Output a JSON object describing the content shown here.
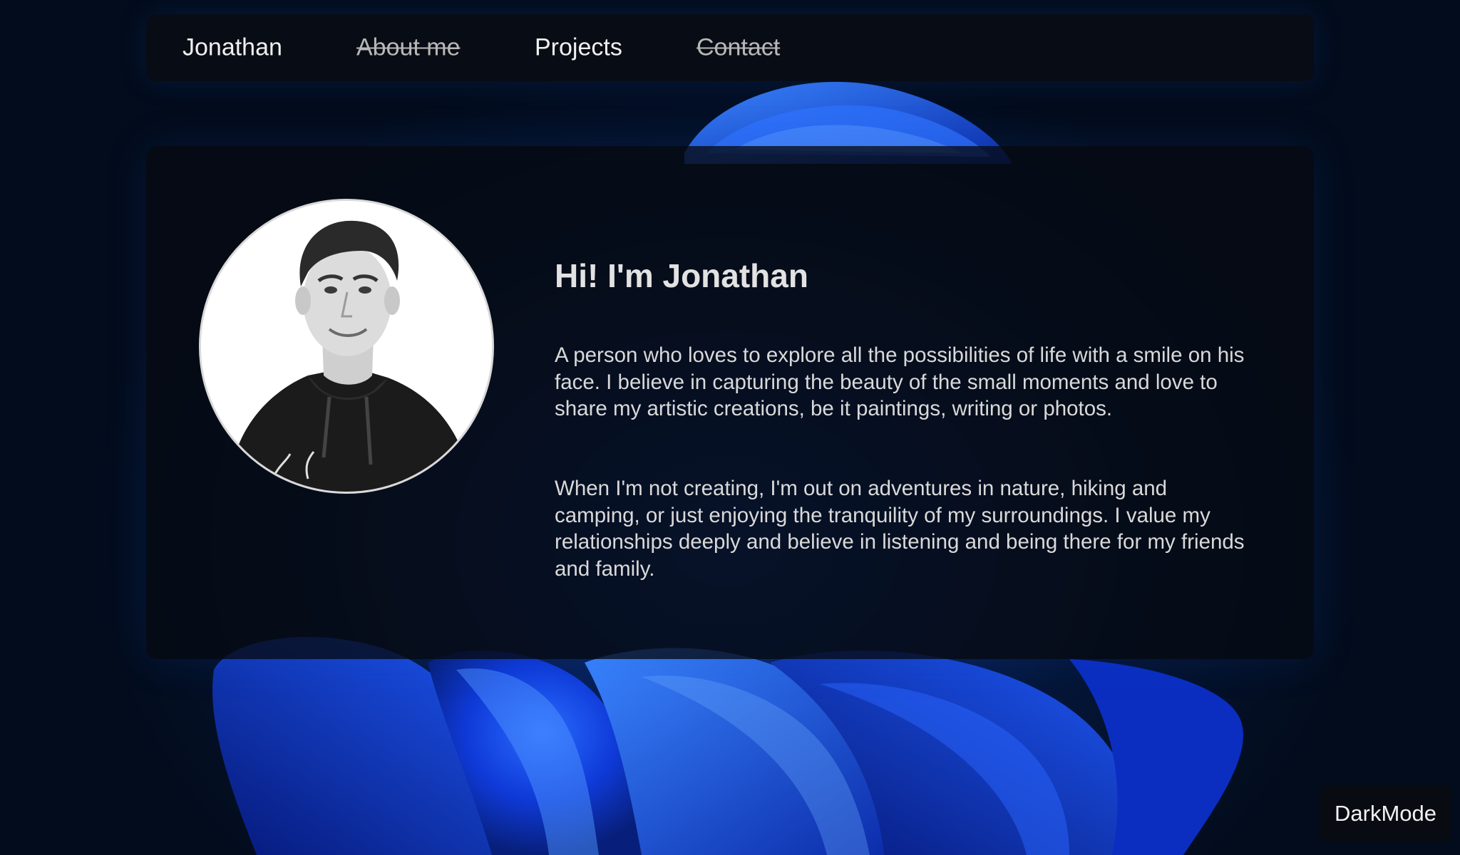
{
  "nav": {
    "brand": "Jonathan",
    "items": [
      {
        "label": "About me",
        "struck": true
      },
      {
        "label": "Projects",
        "struck": false
      },
      {
        "label": "Contact",
        "struck": true
      }
    ]
  },
  "hero": {
    "heading": "Hi! I'm Jonathan",
    "paragraphs": [
      "A person who loves to explore all the possibilities of life with a smile on his face. I believe in capturing the beauty of the small moments and love to share my artistic creations, be it paintings, writing or photos.",
      "When I'm not creating, I'm out on adventures in nature, hiking and camping, or just enjoying the tranquility of my surroundings. I value my relationships deeply and believe in listening and being there for my friends and family."
    ]
  },
  "theme_toggle": {
    "label": "DarkMode"
  },
  "colors": {
    "background": "#04101f",
    "accent_blue": "#1a4fff",
    "panel": "#080c14"
  }
}
